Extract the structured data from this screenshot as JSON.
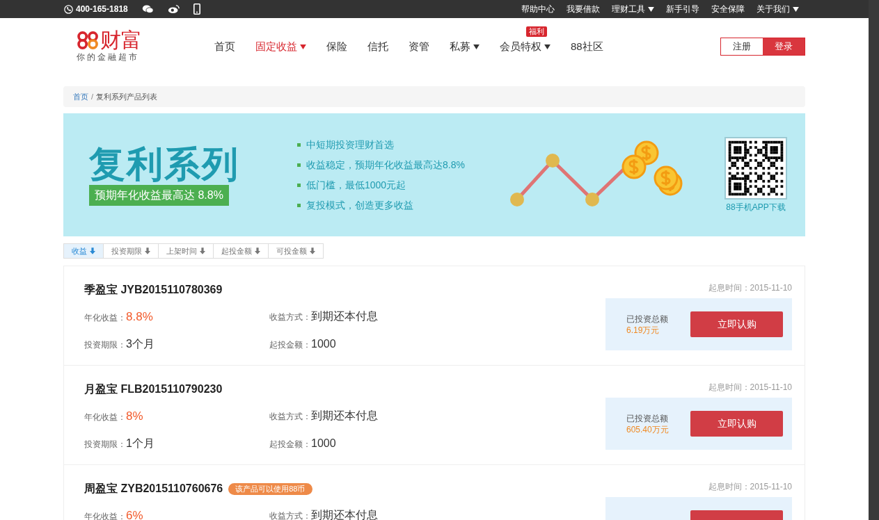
{
  "top_bar": {
    "phone": "400-165-1818",
    "links": [
      {
        "label": "帮助中心",
        "dropdown": false
      },
      {
        "label": "我要借款",
        "dropdown": false
      },
      {
        "label": "理财工具",
        "dropdown": true
      },
      {
        "label": "新手引导",
        "dropdown": false
      },
      {
        "label": "安全保障",
        "dropdown": false
      },
      {
        "label": "关于我们",
        "dropdown": true
      }
    ]
  },
  "header": {
    "logo_text": "财富",
    "tagline": "你的金融超市",
    "nav": [
      {
        "label": "首页",
        "selected": false,
        "dropdown": false
      },
      {
        "label": "固定收益",
        "selected": true,
        "dropdown": true
      },
      {
        "label": "保险",
        "selected": false,
        "dropdown": false
      },
      {
        "label": "信托",
        "selected": false,
        "dropdown": false
      },
      {
        "label": "资管",
        "selected": false,
        "dropdown": false
      },
      {
        "label": "私募",
        "selected": false,
        "dropdown": true
      },
      {
        "label": "会员特权",
        "selected": false,
        "dropdown": true,
        "badge": "福利"
      },
      {
        "label": "88社区",
        "selected": false,
        "dropdown": false
      }
    ],
    "register": "注册",
    "login": "登录"
  },
  "breadcrumb": {
    "separator": "/",
    "items": [
      "首页",
      "复利系列产品列表"
    ]
  },
  "banner": {
    "title": "复利系列",
    "subtitle": "预期年化收益最高达 8.8%",
    "points": [
      "中短期投资理财首选",
      "收益稳定，预期年化收益最高达8.8%",
      "低门槛，最低1000元起",
      "复投模式，创造更多收益"
    ],
    "qr_caption": "88手机APP下载"
  },
  "sort_tabs": [
    {
      "label": "收益",
      "selected": true
    },
    {
      "label": "投资期限",
      "selected": false
    },
    {
      "label": "上架时间",
      "selected": false
    },
    {
      "label": "起投金额",
      "selected": false
    },
    {
      "label": "可投金额",
      "selected": false
    }
  ],
  "products": [
    {
      "name": "季盈宝 JYB2015110780369",
      "start_label": "起息时间：",
      "start_date": "2015-11-10",
      "fields": [
        [
          {
            "label": "年化收益：",
            "value": "8.8%",
            "kind": "rate"
          },
          {
            "label": "收益方式：",
            "value": "到期还本付息",
            "kind": "plain"
          }
        ],
        [
          {
            "label": "投资期限：",
            "value": "3个月",
            "kind": "plain"
          },
          {
            "label": "起投金额：",
            "value": "1000",
            "kind": "plain"
          }
        ]
      ],
      "invested_label": "已投资总额",
      "invested": "6.19万元",
      "button": "立即认购"
    },
    {
      "name": "月盈宝 FLB2015110790230",
      "start_label": "起息时间：",
      "start_date": "2015-11-10",
      "fields": [
        [
          {
            "label": "年化收益：",
            "value": "8%",
            "kind": "rate"
          },
          {
            "label": "收益方式：",
            "value": "到期还本付息",
            "kind": "plain"
          }
        ],
        [
          {
            "label": "投资期限：",
            "value": "1个月",
            "kind": "plain"
          },
          {
            "label": "起投金额：",
            "value": "1000",
            "kind": "plain"
          }
        ]
      ],
      "invested_label": "已投资总额",
      "invested": "605.40万元",
      "button": "立即认购"
    },
    {
      "name": "周盈宝 ZYB2015110760676",
      "tag": "该产品可以使用88币",
      "start_label": "起息时间：",
      "start_date": "2015-11-10",
      "fields": [
        [
          {
            "label": "年化收益：",
            "value": "6%",
            "kind": "rate"
          },
          {
            "label": "收益方式：",
            "value": "到期还本付息",
            "kind": "plain"
          }
        ]
      ]
    }
  ]
}
